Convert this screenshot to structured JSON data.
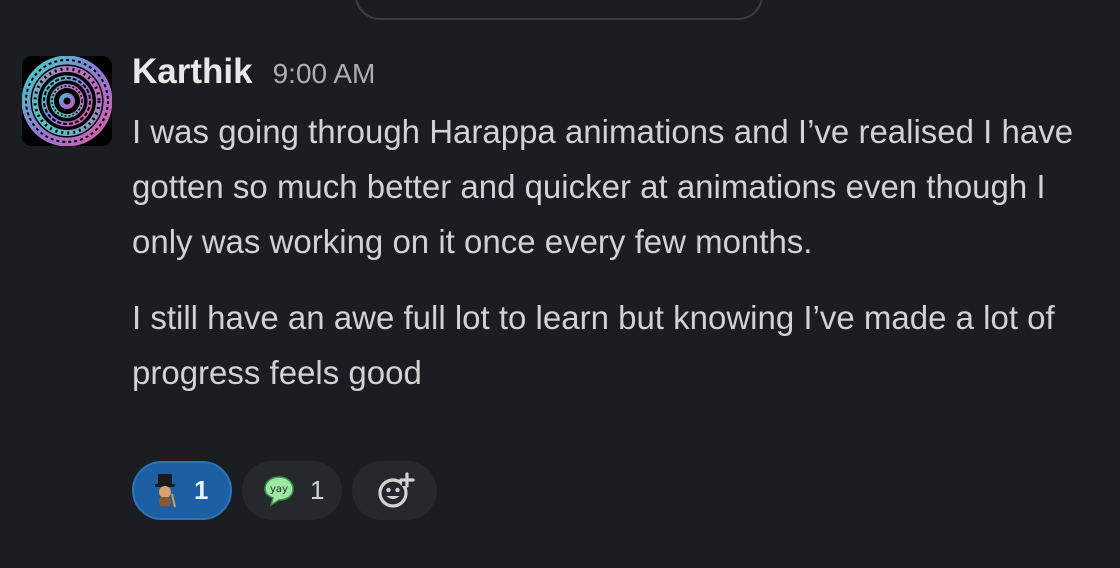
{
  "message": {
    "sender": "Karthik",
    "time": "9:00 AM",
    "paragraphs": [
      "I was going through Harappa animations and I’ve realised I have gotten so much better and quicker at animations even though I only was working on it once every few months.",
      "I still have an awe full lot to learn but knowing I’ve made a lot of progress feels good"
    ]
  },
  "reactions": [
    {
      "emoji": "gentleman-emoji",
      "count": "1",
      "active": true
    },
    {
      "emoji": "yay-emoji",
      "label": "yay",
      "count": "1",
      "active": false
    }
  ],
  "add_reaction": {
    "icon": "add-reaction-icon"
  },
  "colors": {
    "background": "#1a1d21",
    "text": "#d1d2d3",
    "active_reaction": "#1d5fa3",
    "reaction_bg": "#25282c"
  }
}
